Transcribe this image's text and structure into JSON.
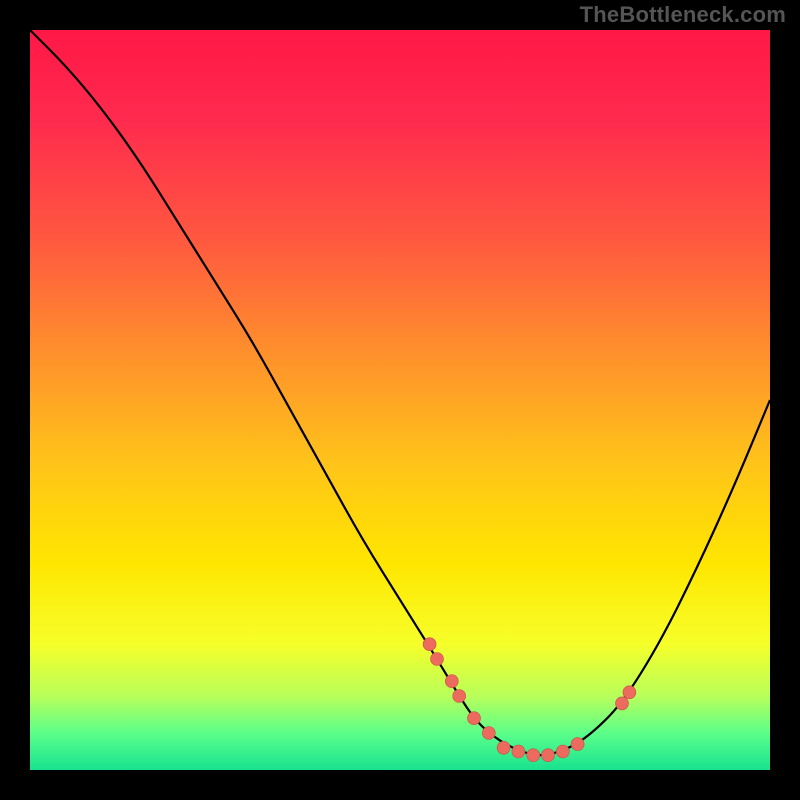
{
  "watermark": "TheBottleneck.com",
  "chart_data": {
    "type": "line",
    "title": "",
    "xlabel": "",
    "ylabel": "",
    "xlim": [
      0,
      100
    ],
    "ylim": [
      0,
      100
    ],
    "grid": false,
    "legend": false,
    "series": [
      {
        "name": "bottleneck-curve",
        "x": [
          0,
          5,
          10,
          15,
          20,
          25,
          30,
          35,
          40,
          45,
          50,
          55,
          58,
          60,
          62,
          65,
          68,
          70,
          73,
          76,
          80,
          85,
          90,
          95,
          100
        ],
        "values": [
          100,
          95,
          89,
          82,
          74,
          66,
          58,
          49,
          40,
          31,
          23,
          15,
          10,
          7,
          5,
          3,
          2,
          2,
          3,
          5,
          9,
          17,
          27,
          38,
          50
        ]
      }
    ],
    "markers": {
      "name": "highlighted-points",
      "x": [
        54,
        55,
        57,
        58,
        60,
        62,
        64,
        66,
        68,
        70,
        72,
        74,
        80,
        81
      ],
      "values": [
        17,
        15,
        12,
        10,
        7,
        5,
        3,
        2.5,
        2,
        2,
        2.5,
        3.5,
        9,
        10.5
      ]
    },
    "gradient_colormap": {
      "top": "#ff1846",
      "mid_upper": "#ff8a2e",
      "mid": "#ffe600",
      "mid_lower": "#b8ff5a",
      "bottom": "#18e28f"
    }
  }
}
